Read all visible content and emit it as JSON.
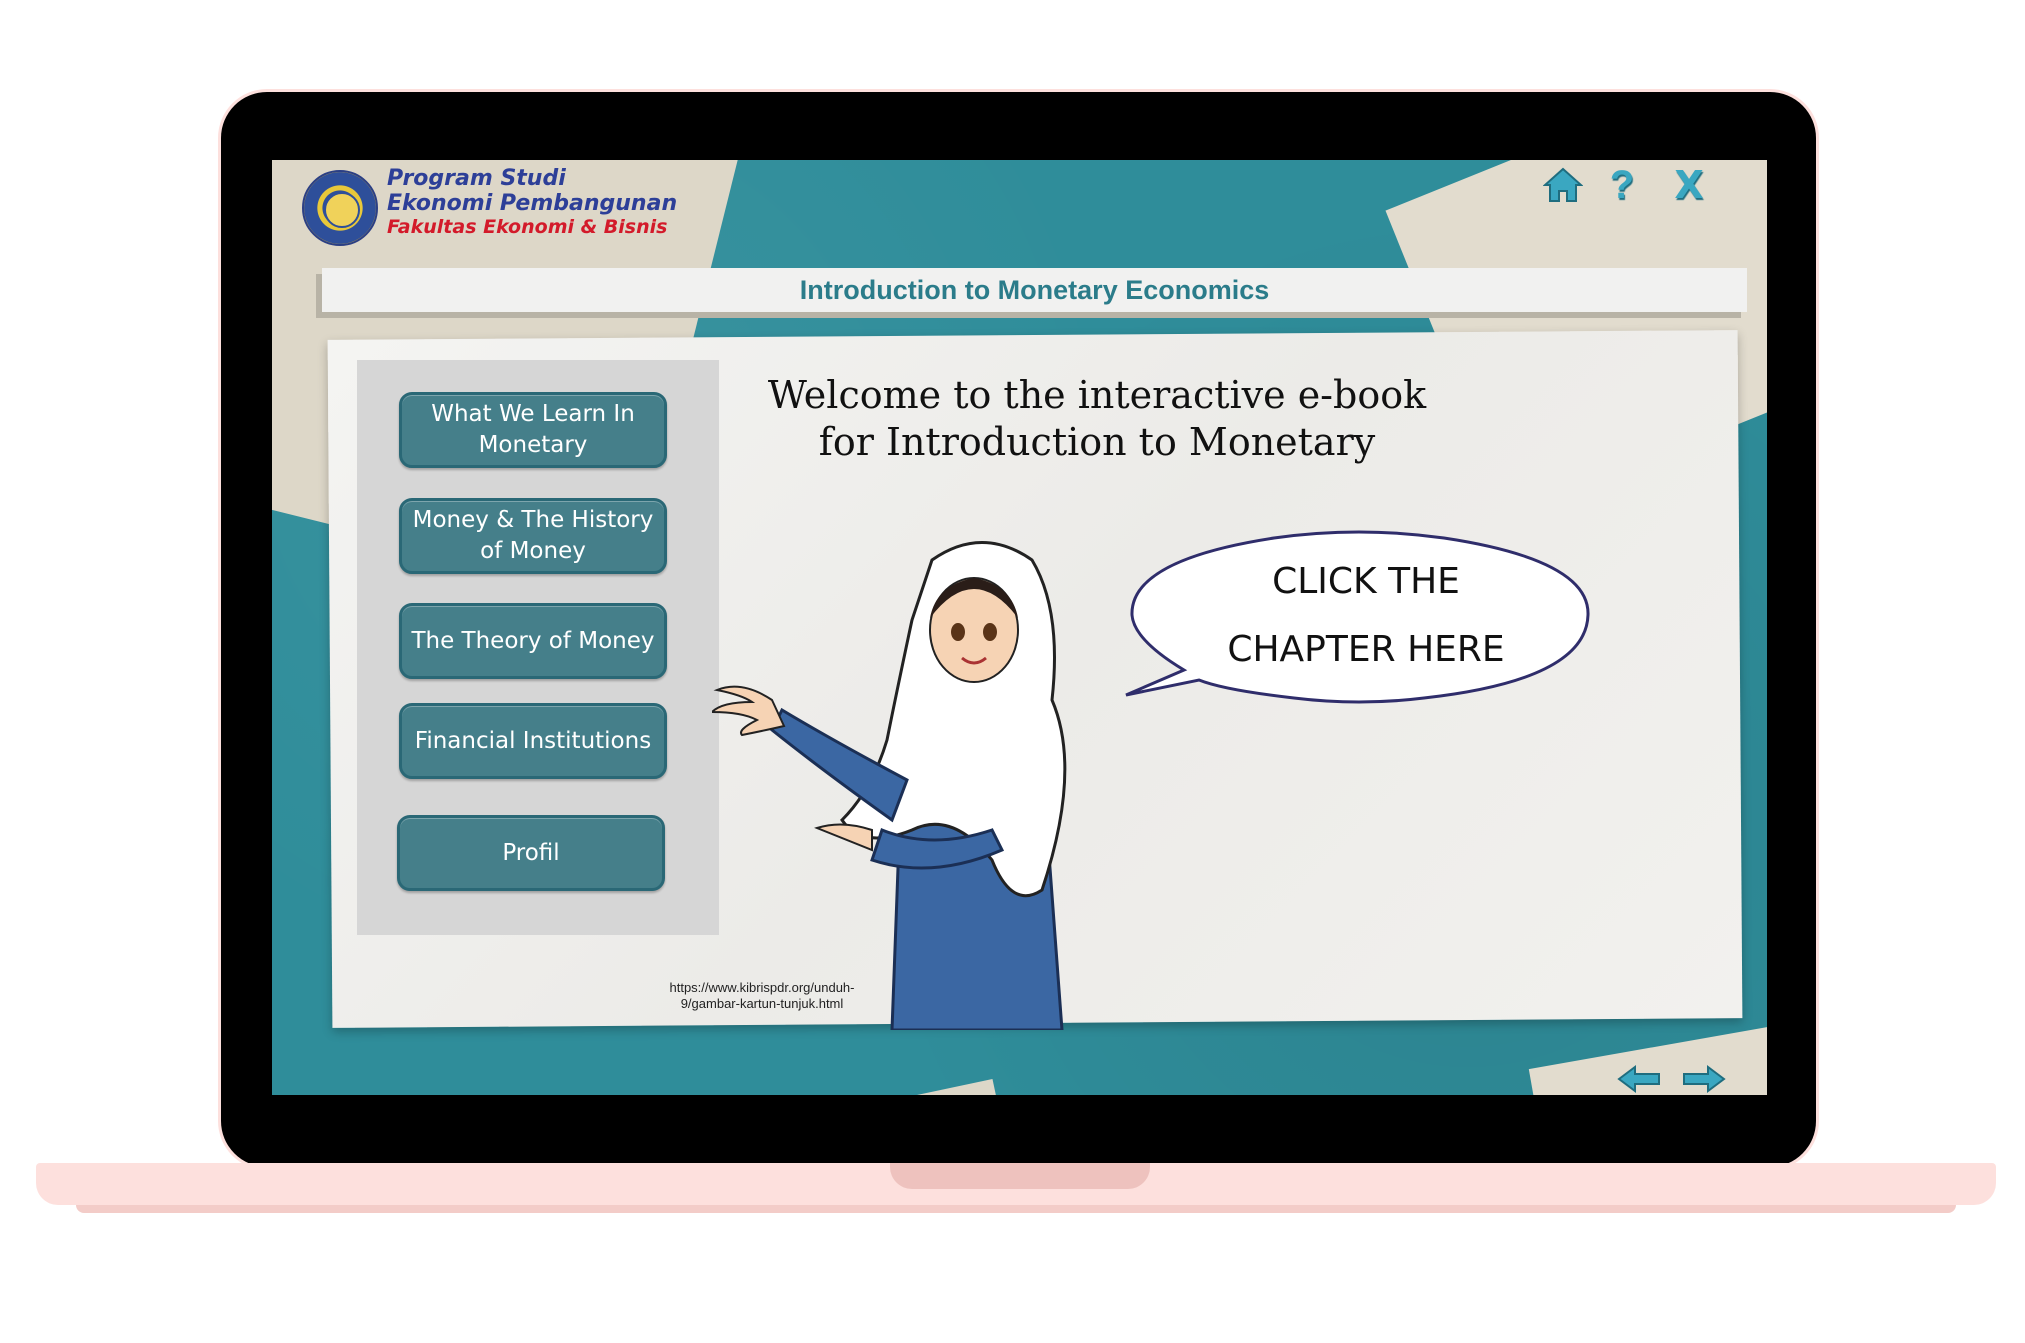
{
  "header": {
    "brand_line1": "Program Studi",
    "brand_line2": "Ekonomi Pembangunan",
    "brand_line3": "Fakultas Ekonomi & Bisnis",
    "help_glyph": "?",
    "close_glyph": "X"
  },
  "title": "Introduction to Monetary Economics",
  "welcome": {
    "line1": "Welcome to the interactive e-book",
    "line2": "for Introduction to Monetary"
  },
  "bubble": {
    "line1": "CLICK THE",
    "line2": "CHAPTER HERE"
  },
  "chapters": [
    {
      "label_line1": "What We Learn In",
      "label_line2": "Monetary"
    },
    {
      "label_line1": "Money & The History",
      "label_line2": "of Money"
    },
    {
      "label": "The Theory of Money"
    },
    {
      "label": "Financial Institutions"
    },
    {
      "label": "Profil"
    }
  ],
  "credit": {
    "line1": "https://www.kibrispdr.org/unduh-",
    "line2": "9/gambar-kartun-tunjuk.html"
  },
  "icons": [
    "home-icon",
    "help-icon",
    "close-icon",
    "arrow-left-icon",
    "arrow-right-icon"
  ],
  "colors": {
    "accent_teal": "#2f8d9a",
    "button": "#457f8a",
    "title_text": "#2b7c8a",
    "laptop_bezel": "#000000",
    "laptop_base": "#fde0dd"
  }
}
